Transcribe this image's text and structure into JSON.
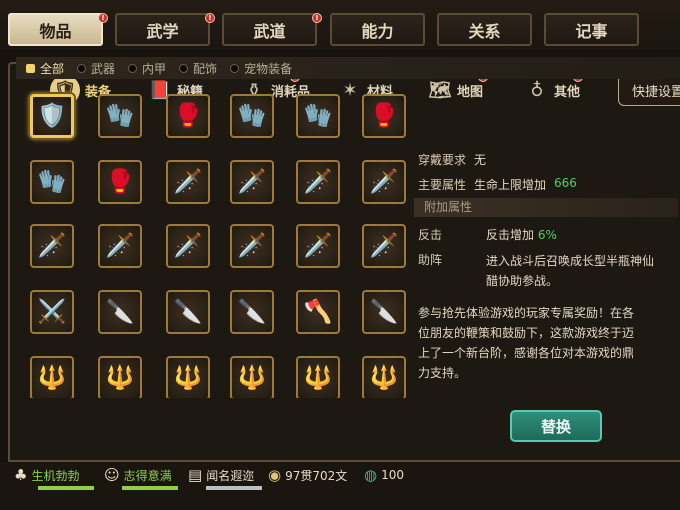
{
  "top_tabs": [
    "物品",
    "武学",
    "武道",
    "能力",
    "关系",
    "记事"
  ],
  "sub_tabs": [
    "装备",
    "秘籍",
    "消耗品",
    "材料",
    "地图",
    "其他"
  ],
  "quick_settings": "快捷设置",
  "filters": [
    "全部",
    "武器",
    "内甲",
    "配饰",
    "宠物装备"
  ],
  "detail": {
    "req_label": "穿戴要求",
    "req_value": "无",
    "main_attr_label": "主要属性",
    "main_attr_text": "生命上限增加",
    "main_attr_value": "666",
    "extra_attr_title": "附加属性",
    "attr1_label": "反击",
    "attr1_text": "反击增加",
    "attr1_value": "6%",
    "attr2_label": "助阵",
    "attr2_line1": "进入战斗后召唤成长型半瓶神仙",
    "attr2_line2": "醋协助参战。",
    "desc_line1": "参与抢先体验游戏的玩家专属奖励！在各",
    "desc_line2": "位朋友的鞭策和鼓励下，这款游戏终于迈",
    "desc_line3": "上了一个新台阶，感谢各位对本游戏的鼎",
    "desc_line4": "力支持。"
  },
  "replace_button": "替换",
  "status": {
    "health": "生机勃勃",
    "mood": "志得意满",
    "fame": "闻名遐迩",
    "money": "97贯702文",
    "other": "100"
  },
  "grid_icons": [
    [
      "🛡️",
      "🧤",
      "🥊",
      "🧤",
      "🧤",
      "🥊"
    ],
    [
      "🧤",
      "🥊",
      "🗡️",
      "🗡️",
      "🗡️",
      "🗡️"
    ],
    [
      "🗡️",
      "🗡️",
      "🗡️",
      "🗡️",
      "🗡️",
      "🗡️"
    ],
    [
      "⚔️",
      "🔪",
      "🔪",
      "🔪",
      "🪓",
      "🔪"
    ],
    [
      "🔱",
      "🔱",
      "🔱",
      "🔱",
      "🔱",
      "🔱"
    ]
  ],
  "colors": {
    "accent": "#f1c95a",
    "green": "#4fd060",
    "button": "#2f8f7b"
  }
}
